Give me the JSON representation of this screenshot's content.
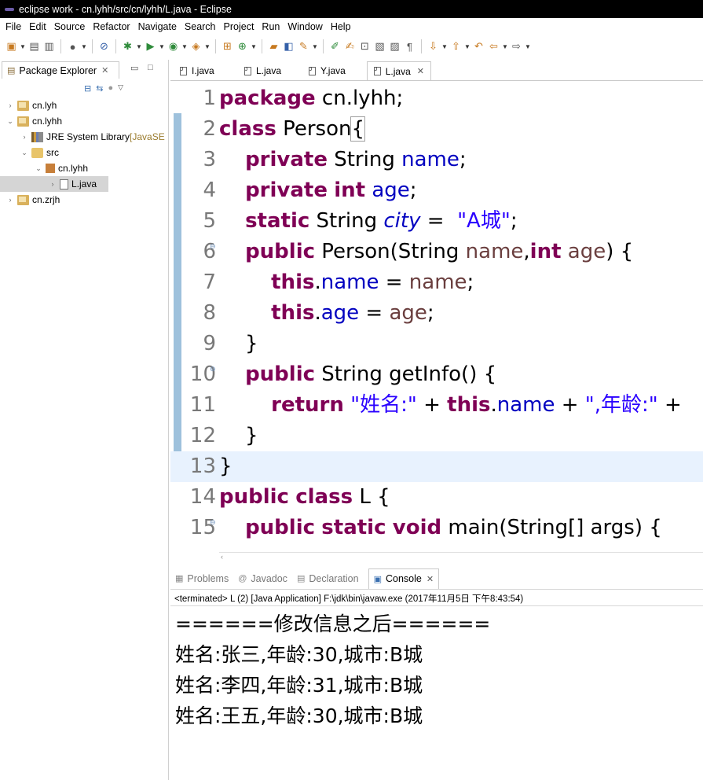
{
  "window_title": "eclipse work - cn.lyhh/src/cn/lyhh/L.java - Eclipse",
  "menu": [
    "File",
    "Edit",
    "Source",
    "Refactor",
    "Navigate",
    "Search",
    "Project",
    "Run",
    "Window",
    "Help"
  ],
  "package_explorer": {
    "title": "Package Explorer",
    "tree": [
      {
        "label": "cn.lyh",
        "extra": "",
        "depth": 0,
        "toggle": "›",
        "icon": "project",
        "selected": false
      },
      {
        "label": "cn.lyhh",
        "extra": "",
        "depth": 0,
        "toggle": "⌄",
        "icon": "project",
        "selected": false
      },
      {
        "label": "JRE System Library ",
        "extra": "[JavaSE",
        "depth": 1,
        "toggle": "›",
        "icon": "library",
        "selected": false
      },
      {
        "label": "src",
        "extra": "",
        "depth": 1,
        "toggle": "⌄",
        "icon": "source-folder",
        "selected": false
      },
      {
        "label": "cn.lyhh",
        "extra": "",
        "depth": 2,
        "toggle": "⌄",
        "icon": "package",
        "selected": false
      },
      {
        "label": "L.java",
        "extra": "",
        "depth": 3,
        "toggle": "›",
        "icon": "java-file",
        "selected": true
      },
      {
        "label": "cn.zrjh",
        "extra": "",
        "depth": 0,
        "toggle": "›",
        "icon": "project",
        "selected": false
      }
    ]
  },
  "editor": {
    "tabs": [
      {
        "label": "I.java",
        "active": false
      },
      {
        "label": "L.java",
        "active": false
      },
      {
        "label": "Y.java",
        "active": false
      },
      {
        "label": "L.java",
        "active": true
      }
    ],
    "lines": [
      {
        "n": "1",
        "fold": "",
        "hl": false,
        "tokens": [
          {
            "t": "package",
            "c": "kw"
          },
          {
            "t": " cn.lyhh;",
            "c": ""
          }
        ]
      },
      {
        "n": "2",
        "fold": "",
        "hl": false,
        "tokens": [
          {
            "t": "class",
            "c": "kw"
          },
          {
            "t": " Person",
            "c": ""
          },
          {
            "t": "{",
            "c": "brk"
          }
        ]
      },
      {
        "n": "3",
        "fold": "",
        "hl": false,
        "tokens": [
          {
            "t": "    ",
            "c": ""
          },
          {
            "t": "private",
            "c": "kw"
          },
          {
            "t": " String ",
            "c": ""
          },
          {
            "t": "name",
            "c": "fld"
          },
          {
            "t": ";",
            "c": ""
          }
        ]
      },
      {
        "n": "4",
        "fold": "",
        "hl": false,
        "tokens": [
          {
            "t": "    ",
            "c": ""
          },
          {
            "t": "private",
            "c": "kw"
          },
          {
            "t": " ",
            "c": ""
          },
          {
            "t": "int",
            "c": "kw"
          },
          {
            "t": " ",
            "c": ""
          },
          {
            "t": "age",
            "c": "fld"
          },
          {
            "t": ";",
            "c": ""
          }
        ]
      },
      {
        "n": "5",
        "fold": "",
        "hl": false,
        "tokens": [
          {
            "t": "    ",
            "c": ""
          },
          {
            "t": "static",
            "c": "kw"
          },
          {
            "t": " String ",
            "c": ""
          },
          {
            "t": "city",
            "c": "stf"
          },
          {
            "t": " =  ",
            "c": ""
          },
          {
            "t": "\"A城\"",
            "c": "str"
          },
          {
            "t": ";",
            "c": ""
          }
        ]
      },
      {
        "n": "6",
        "fold": "⊖",
        "hl": false,
        "tokens": [
          {
            "t": "    ",
            "c": ""
          },
          {
            "t": "public",
            "c": "kw"
          },
          {
            "t": " Person(String ",
            "c": ""
          },
          {
            "t": "name",
            "c": "par"
          },
          {
            "t": ",",
            "c": ""
          },
          {
            "t": "int",
            "c": "kw"
          },
          {
            "t": " ",
            "c": ""
          },
          {
            "t": "age",
            "c": "par"
          },
          {
            "t": ") {",
            "c": ""
          }
        ]
      },
      {
        "n": "7",
        "fold": "",
        "hl": false,
        "tokens": [
          {
            "t": "        ",
            "c": ""
          },
          {
            "t": "this",
            "c": "kw"
          },
          {
            "t": ".",
            "c": ""
          },
          {
            "t": "name",
            "c": "fld"
          },
          {
            "t": " = ",
            "c": ""
          },
          {
            "t": "name",
            "c": "par"
          },
          {
            "t": ";",
            "c": ""
          }
        ]
      },
      {
        "n": "8",
        "fold": "",
        "hl": false,
        "tokens": [
          {
            "t": "        ",
            "c": ""
          },
          {
            "t": "this",
            "c": "kw"
          },
          {
            "t": ".",
            "c": ""
          },
          {
            "t": "age",
            "c": "fld"
          },
          {
            "t": " = ",
            "c": ""
          },
          {
            "t": "age",
            "c": "par"
          },
          {
            "t": ";",
            "c": ""
          }
        ]
      },
      {
        "n": "9",
        "fold": "",
        "hl": false,
        "tokens": [
          {
            "t": "    }",
            "c": ""
          }
        ]
      },
      {
        "n": "10",
        "fold": "⊖",
        "hl": false,
        "tokens": [
          {
            "t": "    ",
            "c": ""
          },
          {
            "t": "public",
            "c": "kw"
          },
          {
            "t": " String getInfo() {",
            "c": ""
          }
        ]
      },
      {
        "n": "11",
        "fold": "",
        "hl": false,
        "tokens": [
          {
            "t": "        ",
            "c": ""
          },
          {
            "t": "return",
            "c": "kw"
          },
          {
            "t": " ",
            "c": ""
          },
          {
            "t": "\"姓名:\"",
            "c": "str"
          },
          {
            "t": " + ",
            "c": ""
          },
          {
            "t": "this",
            "c": "kw"
          },
          {
            "t": ".",
            "c": ""
          },
          {
            "t": "name",
            "c": "fld"
          },
          {
            "t": " + ",
            "c": ""
          },
          {
            "t": "\",年龄:\"",
            "c": "str"
          },
          {
            "t": " +",
            "c": ""
          }
        ]
      },
      {
        "n": "12",
        "fold": "",
        "hl": false,
        "tokens": [
          {
            "t": "    }",
            "c": ""
          }
        ]
      },
      {
        "n": "13",
        "fold": "",
        "hl": true,
        "tokens": [
          {
            "t": "}",
            "c": ""
          }
        ]
      },
      {
        "n": "14",
        "fold": "",
        "hl": false,
        "tokens": [
          {
            "t": "public",
            "c": "kw"
          },
          {
            "t": " ",
            "c": ""
          },
          {
            "t": "class",
            "c": "kw"
          },
          {
            "t": " L {",
            "c": ""
          }
        ]
      },
      {
        "n": "15",
        "fold": "⊖",
        "hl": false,
        "tokens": [
          {
            "t": "    ",
            "c": ""
          },
          {
            "t": "public",
            "c": "kw"
          },
          {
            "t": " ",
            "c": ""
          },
          {
            "t": "static",
            "c": "kw"
          },
          {
            "t": " ",
            "c": ""
          },
          {
            "t": "void",
            "c": "kw"
          },
          {
            "t": " main(String[] args) {",
            "c": ""
          }
        ]
      }
    ]
  },
  "bottom_panel": {
    "tabs": [
      {
        "label": "Problems",
        "icon": "problems-icon",
        "glyph": "▦",
        "active": false
      },
      {
        "label": "Javadoc",
        "icon": "javadoc-icon",
        "glyph": "@",
        "active": false
      },
      {
        "label": "Declaration",
        "icon": "declaration-icon",
        "glyph": "▤",
        "active": false
      },
      {
        "label": "Console",
        "icon": "console-icon",
        "glyph": "▣",
        "active": true
      }
    ],
    "status": "<terminated> L (2) [Java Application] F:\\jdk\\bin\\javaw.exe (2017年11月5日 下午8:43:54)",
    "output": [
      "======修改信息之后======",
      "姓名:张三,年龄:30,城市:B城",
      "姓名:李四,年龄:31,城市:B城",
      "姓名:王五,年龄:30,城市:B城"
    ]
  }
}
